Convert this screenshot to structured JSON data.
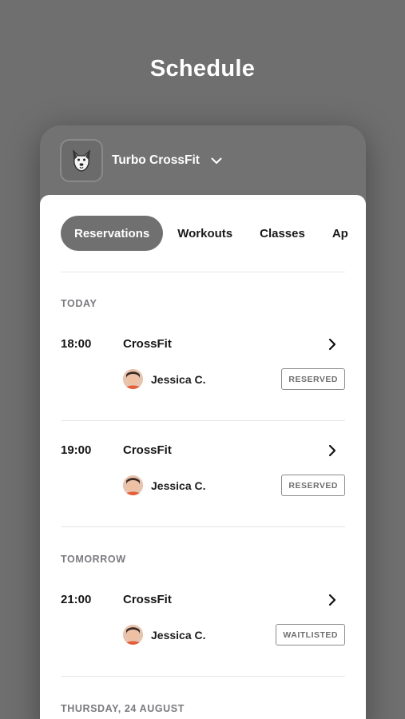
{
  "page": {
    "title": "Schedule"
  },
  "gym": {
    "name": "Turbo CrossFit",
    "logo_icon": "dog-logo-icon",
    "dropdown_icon": "chevron-down-icon"
  },
  "tabs": [
    {
      "label": "Reservations",
      "active": true
    },
    {
      "label": "Workouts",
      "active": false
    },
    {
      "label": "Classes",
      "active": false
    },
    {
      "label": "Ap",
      "active": false
    }
  ],
  "sections": [
    {
      "label": "TODAY",
      "items": [
        {
          "time": "18:00",
          "class_name": "CrossFit",
          "coach": "Jessica C.",
          "status": "RESERVED"
        },
        {
          "time": "19:00",
          "class_name": "CrossFit",
          "coach": "Jessica C.",
          "status": "RESERVED"
        }
      ]
    },
    {
      "label": "TOMORROW",
      "items": [
        {
          "time": "21:00",
          "class_name": "CrossFit",
          "coach": "Jessica C.",
          "status": "WAITLISTED"
        }
      ]
    },
    {
      "label": "THURSDAY, 24 AUGUST",
      "items": []
    }
  ],
  "colors": {
    "background": "#6f6f6f",
    "active_tab": "#707070",
    "card": "#ffffff",
    "text": "#151515",
    "muted": "#7a7a80"
  }
}
